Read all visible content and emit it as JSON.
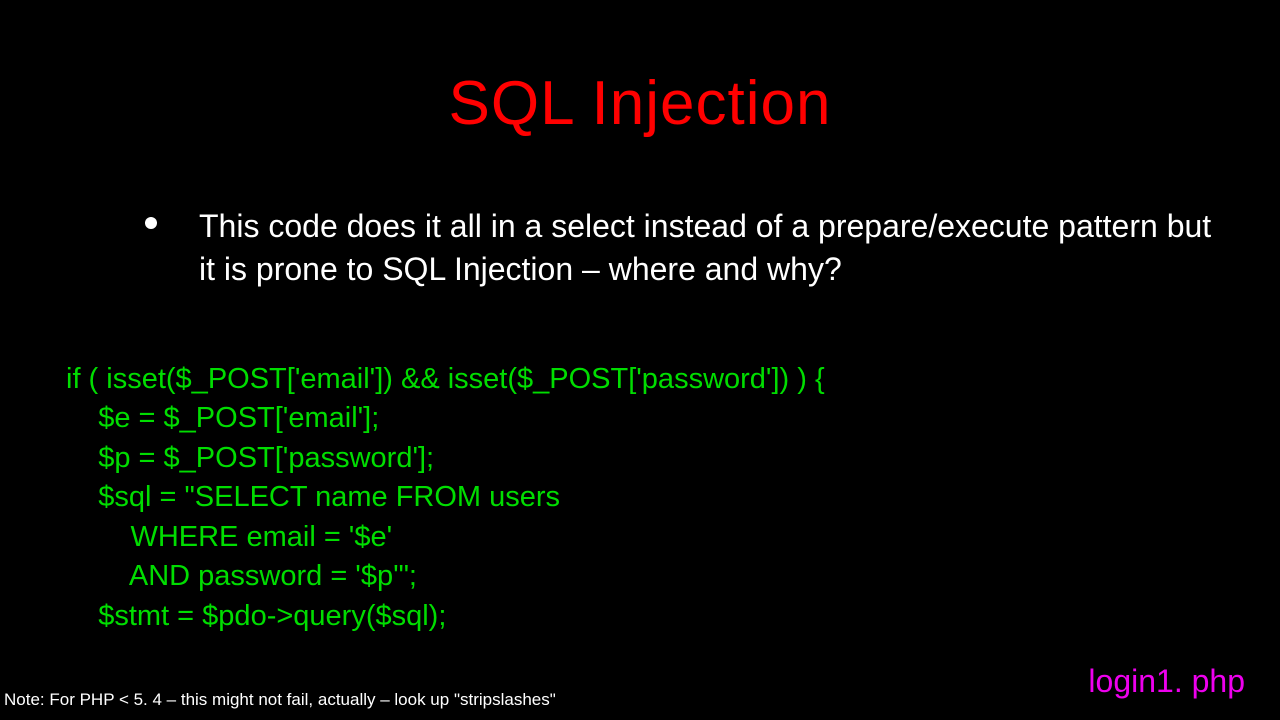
{
  "title": "SQL Injection",
  "bullet": {
    "text": "This code does it all in a select instead of a prepare/execute pattern but it is prone to SQL Injection – where and why?"
  },
  "code": {
    "lines": "if ( isset($_POST['email']) && isset($_POST['password']) ) {\n    $e = $_POST['email'];\n    $p = $_POST['password'];\n    $sql = \"SELECT name FROM users\n        WHERE email = '$e'\n        AND password = '$p'\";\n    $stmt = $pdo->query($sql);"
  },
  "footer": {
    "note": "Note: For PHP < 5. 4 – this might not fail, actually – look up \"stripslashes\""
  },
  "filename": "login1. php"
}
